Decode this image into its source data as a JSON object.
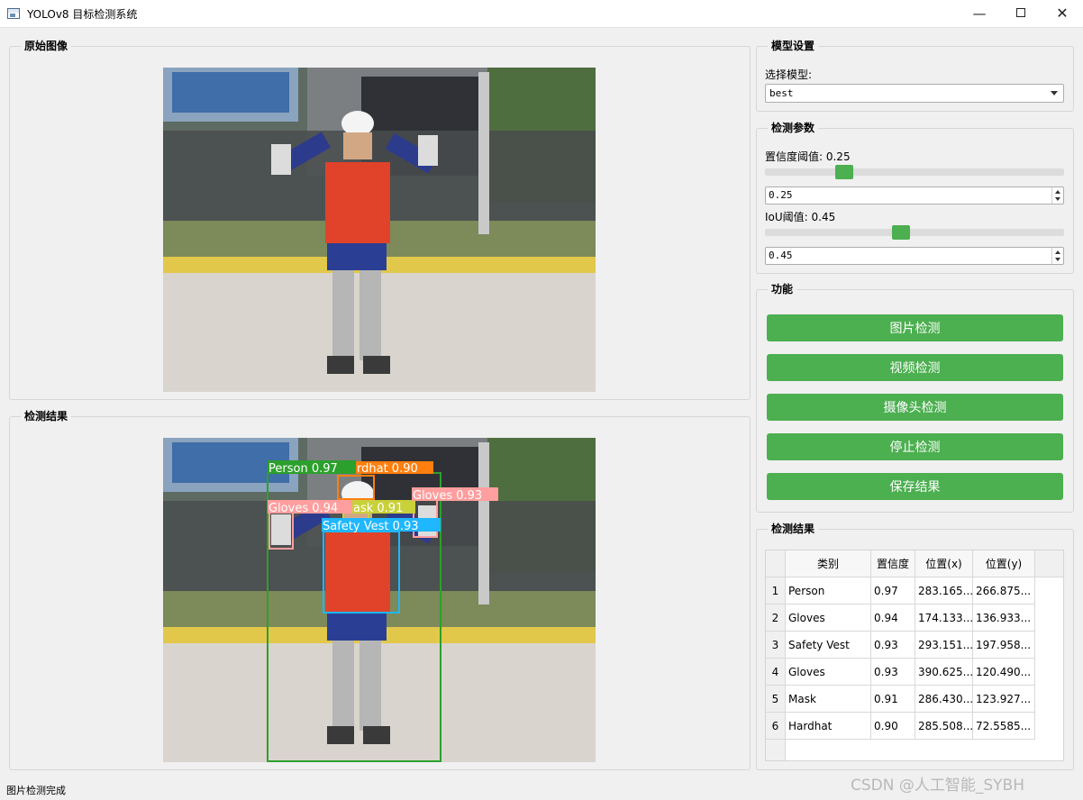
{
  "window": {
    "title": "YOLOv8 目标检测系统"
  },
  "original_group": {
    "title": "原始图像"
  },
  "result_image_group": {
    "title": "检测结果"
  },
  "model_group": {
    "title": "模型设置",
    "select_label": "选择模型:",
    "model_value": "best"
  },
  "params_group": {
    "title": "检测参数",
    "conf_label": "置信度阈值: 0.25",
    "conf_value": "0.25",
    "conf_level": 0.25,
    "iou_label": "IoU阈值: 0.45",
    "iou_value": "0.45",
    "iou_level": 0.45
  },
  "func_group": {
    "title": "功能",
    "buttons": [
      "图片检测",
      "视频检测",
      "摄像头检测",
      "停止检测",
      "保存结果"
    ]
  },
  "table_group": {
    "title": "检测结果",
    "headers": [
      "类别",
      "置信度",
      "位置(x)",
      "位置(y)"
    ],
    "rows": [
      {
        "num": "1",
        "cls": "Person",
        "conf": "0.97",
        "x": "283.165...",
        "y": "266.875..."
      },
      {
        "num": "2",
        "cls": "Gloves",
        "conf": "0.94",
        "x": "174.133...",
        "y": "136.933..."
      },
      {
        "num": "3",
        "cls": "Safety Vest",
        "conf": "0.93",
        "x": "293.151...",
        "y": "197.958..."
      },
      {
        "num": "4",
        "cls": "Gloves",
        "conf": "0.93",
        "x": "390.625...",
        "y": "120.490..."
      },
      {
        "num": "5",
        "cls": "Mask",
        "conf": "0.91",
        "x": "286.430...",
        "y": "123.927..."
      },
      {
        "num": "6",
        "cls": "Hardhat",
        "conf": "0.90",
        "x": "285.508...",
        "y": "72.5585..."
      }
    ]
  },
  "detections": [
    {
      "label": "Person 0.97",
      "color": "#2ca02c"
    },
    {
      "label": "rdhat 0.90",
      "color": "#ff7f0e"
    },
    {
      "label": "Gloves 0.94",
      "color": "#ff9e9e"
    },
    {
      "label": "ask 0.91",
      "color": "#c8d13a"
    },
    {
      "label": "Gloves 0.93",
      "color": "#ff9e9e"
    },
    {
      "label": "Safety Vest 0.93",
      "color": "#1fb7ff"
    }
  ],
  "status_text": "图片检测完成",
  "watermark": "CSDN @人工智能_SYBH",
  "colors": {
    "accent": "#4caf50"
  }
}
